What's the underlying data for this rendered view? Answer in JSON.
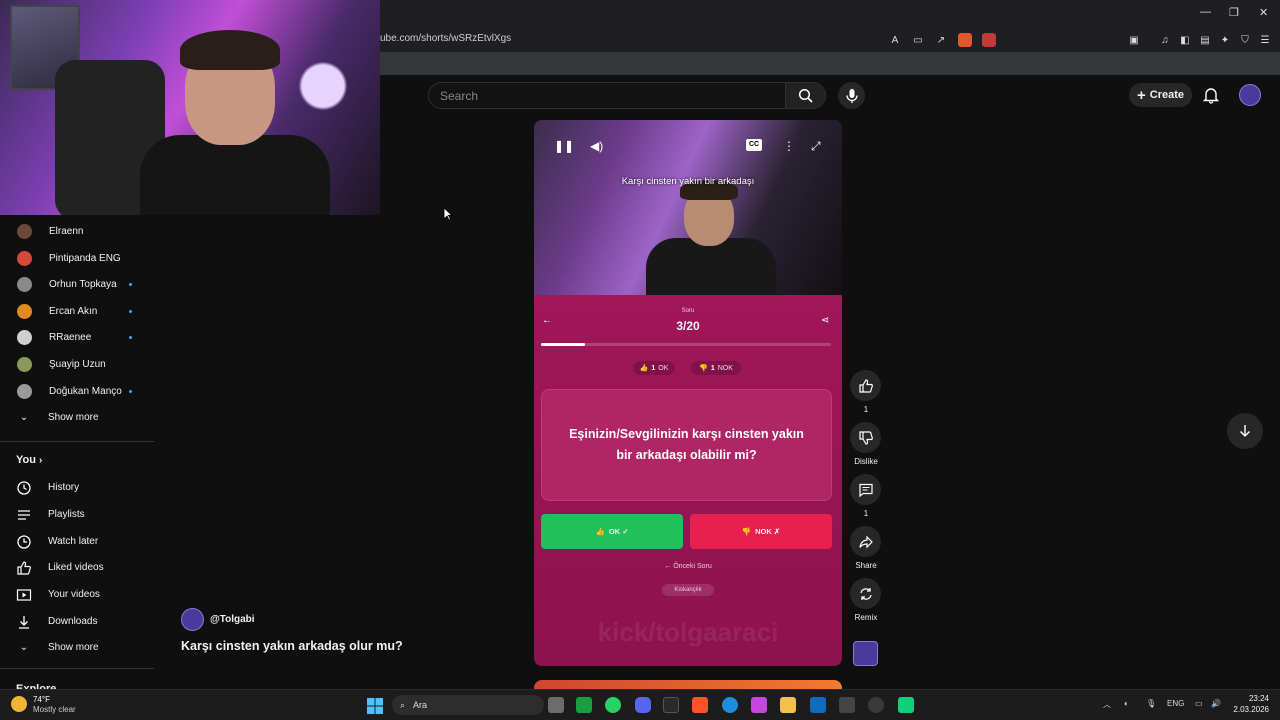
{
  "browser": {
    "url": "ube.com/shorts/wSRzEtvlXgs"
  },
  "header": {
    "search_placeholder": "Search",
    "create_label": "Create"
  },
  "sidebar": {
    "subscriptions": [
      {
        "name": "Elraenn",
        "color": "#6b4a3a",
        "live": false
      },
      {
        "name": "Pintipanda ENG",
        "color": "#d44a3a",
        "live": false
      },
      {
        "name": "Orhun Topkaya",
        "color": "#8a8a8a",
        "live": true
      },
      {
        "name": "Ercan Akın",
        "color": "#e38a1e",
        "live": true
      },
      {
        "name": "RRaenee",
        "color": "#cfcfcf",
        "live": true
      },
      {
        "name": "Şuayip Uzun",
        "color": "#8b9a5a",
        "live": false
      },
      {
        "name": "Doğukan Manço",
        "color": "#9a9a9a",
        "live": true
      }
    ],
    "show_more_1": "Show more",
    "you_label": "You",
    "you_items": [
      {
        "label": "History",
        "icon": "history-icon"
      },
      {
        "label": "Playlists",
        "icon": "playlists-icon"
      },
      {
        "label": "Watch later",
        "icon": "clock-icon"
      },
      {
        "label": "Liked videos",
        "icon": "thumb-up-icon"
      },
      {
        "label": "Your videos",
        "icon": "video-icon"
      },
      {
        "label": "Downloads",
        "icon": "download-icon"
      }
    ],
    "show_more_2": "Show more",
    "explore_label": "Explore"
  },
  "short": {
    "caption": "Karşı cinsten yakın bir arkadaşı",
    "quiz": {
      "soru_label": "Soru",
      "soru_num": "3/20",
      "progress": 0.15,
      "ok_count": "1",
      "ok_label": "OK",
      "nok_count": "1",
      "nok_label": "NOK",
      "question": "Eşinizin/Sevgilinizin karşı cinsten yakın bir arkadaşı olabilir mi?",
      "ok_button": "OK ✓",
      "nok_button": "NOK ✗",
      "prev_label": "← Önceki Soru",
      "tag": "Kıskançlık",
      "watermark": "kick/tolgaaraci"
    }
  },
  "actions": {
    "like_count": "1",
    "dislike_label": "Dislike",
    "comment_count": "1",
    "share_label": "Share",
    "remix_label": "Remix"
  },
  "channel": {
    "handle": "@Tolgabi",
    "title": "Karşı cinsten yakın arkadaş olur mu?"
  },
  "taskbar": {
    "weather_temp": "74°F",
    "weather_desc": "Mostly clear",
    "search_label": "Ara",
    "lang": "ENG",
    "time": "23:24",
    "date": "2.03.2026"
  }
}
